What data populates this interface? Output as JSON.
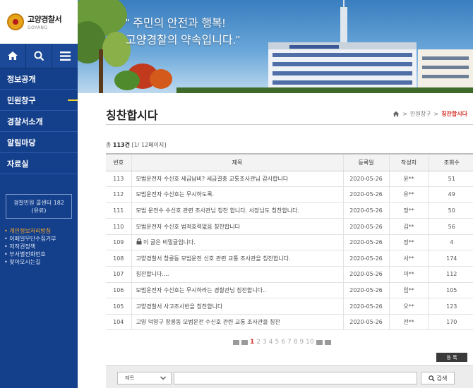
{
  "brand": {
    "title": "고양경찰서",
    "subtitle": "GOYANG"
  },
  "icons": [
    "home-icon",
    "search-icon",
    "menu-icon"
  ],
  "nav": [
    {
      "label": "정보공개",
      "active": false
    },
    {
      "label": "민원창구",
      "active": true
    },
    {
      "label": "경찰서소개",
      "active": false
    },
    {
      "label": "알림마당",
      "active": false
    },
    {
      "label": "자료실",
      "active": false
    }
  ],
  "callcenter": {
    "line1": "경찰민원 콜센터 182",
    "line2": "(유료)"
  },
  "quick_links": [
    {
      "label": "개인정보처리방침",
      "active": true
    },
    {
      "label": "이메일무단수집거부",
      "active": false
    },
    {
      "label": "저작권정책",
      "active": false
    },
    {
      "label": "부서별전화번호",
      "active": false
    },
    {
      "label": "찾아오시는길",
      "active": false
    }
  ],
  "banner": {
    "line1": "\" 주민의 안전과 행복!",
    "line2": "고양경찰의 약속입니다.\""
  },
  "page": {
    "title": "칭찬합시다"
  },
  "breadcrumb": {
    "home_icon": "home-icon",
    "sep": ">",
    "parent": "민원창구",
    "current": "칭찬합시다"
  },
  "total": {
    "prefix": "총",
    "count": "113건",
    "pages": "[1/ 12페이지]"
  },
  "table": {
    "headers": [
      "번호",
      "제목",
      "등록일",
      "작성자",
      "조회수"
    ],
    "rows": [
      {
        "no": "113",
        "title": "모범운전자 수신호 세금납비? 세금결충 교통조사관님 감사합니다",
        "date": "2020-05-26",
        "author": "윤**",
        "views": "51",
        "locked": false
      },
      {
        "no": "112",
        "title": "모범운전자 수신호는 무시하도록.",
        "date": "2020-05-26",
        "author": "유**",
        "views": "49",
        "locked": false
      },
      {
        "no": "111",
        "title": "모범 운전수 수신호 관련 조사관님 칭찬 합니다. 서장님도 칭찬합니다.",
        "date": "2020-05-26",
        "author": "정**",
        "views": "50",
        "locked": false
      },
      {
        "no": "110",
        "title": "모범운전자 수신호 법적효력없음 칭찬합니다",
        "date": "2020-05-26",
        "author": "김**",
        "views": "56",
        "locked": false
      },
      {
        "no": "109",
        "title": "이 글은 비밀글입니다.",
        "date": "2020-05-26",
        "author": "정**",
        "views": "4",
        "locked": true
      },
      {
        "no": "108",
        "title": "고양경찰서 창릉동 모범운전 신호 관련 교통 조사관을 칭찬합니다.",
        "date": "2020-05-26",
        "author": "서**",
        "views": "174",
        "locked": false
      },
      {
        "no": "107",
        "title": "칭찬합니다....",
        "date": "2020-05-26",
        "author": "이**",
        "views": "112",
        "locked": false
      },
      {
        "no": "106",
        "title": "모범운전자 수신호는 무시하라는 경찰관님 칭찬합니다..",
        "date": "2020-05-26",
        "author": "임**",
        "views": "105",
        "locked": false
      },
      {
        "no": "105",
        "title": "고양경찰서 사고조사반을 칭찬합니다",
        "date": "2020-05-26",
        "author": "오**",
        "views": "123",
        "locked": false
      },
      {
        "no": "104",
        "title": "고양 덕양구 창릉동 모범운전 수신호 관련 교통 조사관을 칭찬",
        "date": "2020-05-26",
        "author": "전**",
        "views": "170",
        "locked": false
      }
    ]
  },
  "pagination": {
    "current": "1",
    "pages": [
      "1",
      "2",
      "3",
      "4",
      "5",
      "6",
      "7",
      "8",
      "9",
      "10"
    ]
  },
  "write_button": {
    "label": "등 록"
  },
  "search": {
    "select_value": "제목",
    "input_value": "",
    "button_label": "검색"
  },
  "colors": {
    "sidebar": "#143f8a",
    "accent": "#d4332a",
    "nav_active_bar": "#f2d22a",
    "quick_link_active": "#f5a52a"
  }
}
